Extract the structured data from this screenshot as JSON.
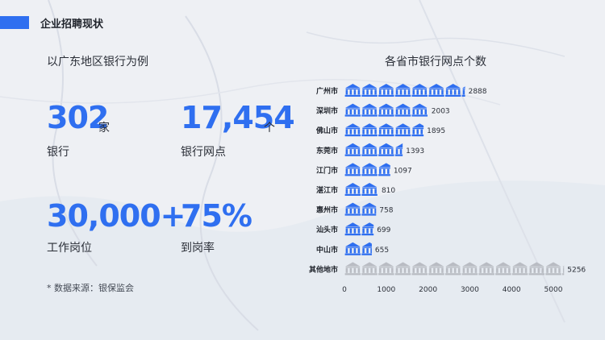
{
  "header": {
    "title": "企业招聘现状"
  },
  "left": {
    "subtitle": "以广东地区银行为例",
    "stats": [
      {
        "value": "302",
        "unit": "家",
        "label": "银行"
      },
      {
        "value": "17,454",
        "unit": "个",
        "label": "银行网点"
      },
      {
        "value": "30,000+",
        "unit": "",
        "label": "工作岗位"
      },
      {
        "value": "75%",
        "unit": "",
        "label": "到岗率"
      }
    ],
    "source": "* 数据来源：银保监会"
  },
  "colors": {
    "accent": "#2f6ff0",
    "other": "#b9bcc3"
  },
  "chart_data": {
    "type": "bar",
    "orientation": "horizontal",
    "style": "pictograph",
    "icon": "bank-icon",
    "title": "各省市银行网点个数",
    "categories": [
      "广州市",
      "深圳市",
      "佛山市",
      "东莞市",
      "江门市",
      "湛江市",
      "惠州市",
      "汕头市",
      "中山市",
      "其他地市"
    ],
    "values": [
      2888,
      2003,
      1895,
      1393,
      1097,
      810,
      758,
      699,
      655,
      5256
    ],
    "xlim": [
      0,
      5500
    ],
    "xticks": [
      0,
      1000,
      2000,
      3000,
      4000,
      5000
    ],
    "xtick_labels": [
      "0",
      "1000",
      "2000",
      "3000",
      "4000",
      "5000"
    ]
  }
}
